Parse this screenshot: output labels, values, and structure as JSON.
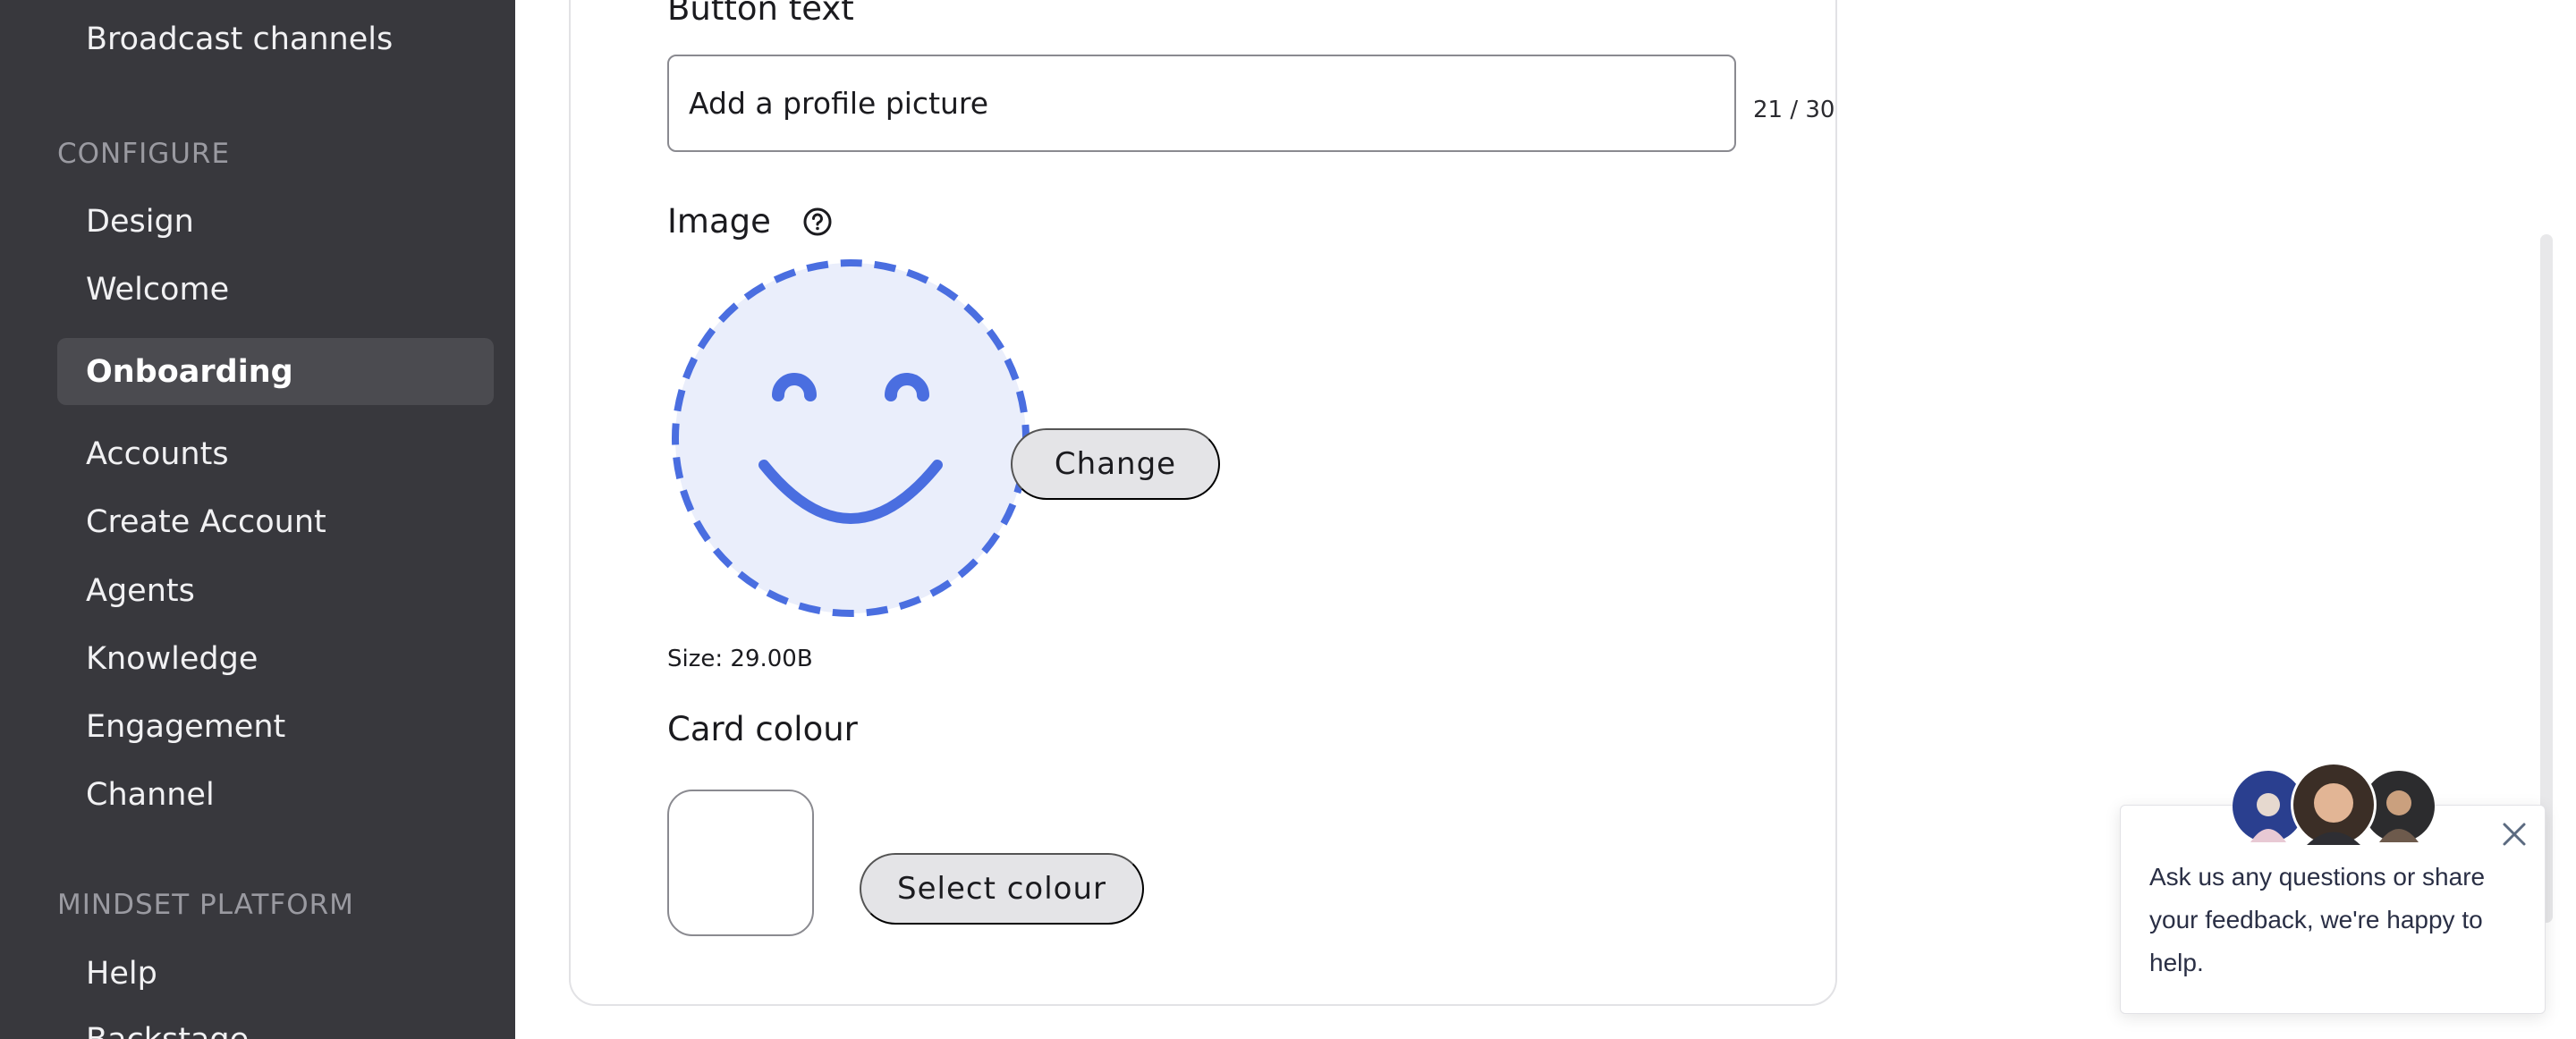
{
  "sidebar": {
    "items": [
      {
        "label": "Broadcast channels"
      },
      {
        "label": "Design"
      },
      {
        "label": "Welcome"
      },
      {
        "label": "Onboarding"
      },
      {
        "label": "Accounts"
      },
      {
        "label": "Create Account"
      },
      {
        "label": "Agents"
      },
      {
        "label": "Knowledge"
      },
      {
        "label": "Engagement"
      },
      {
        "label": "Channel"
      },
      {
        "label": "Help"
      },
      {
        "label": "Backstage"
      }
    ],
    "sections": [
      {
        "label": "CONFIGURE"
      },
      {
        "label": "MINDSET PLATFORM"
      }
    ],
    "active_item": "Onboarding"
  },
  "form": {
    "button_text_label": "Button text",
    "button_text_value": "Add a profile picture",
    "button_text_counter": "21 / 30",
    "image_label": "Image",
    "image_help_icon": "question-circle-icon",
    "image_preview_icon": "smiley-face-icon",
    "change_button": "Change",
    "size_text": "Size: 29.00B",
    "card_colour_label": "Card colour",
    "card_colour_value": "#ffffff",
    "select_colour_button": "Select colour"
  },
  "chat_widget": {
    "message": "Ask us any questions or share your feedback, we're happy to help.",
    "close_icon": "close-icon"
  },
  "colors": {
    "sidebar_bg": "#38383d",
    "sidebar_active_bg": "#4b4b50",
    "accent_blue": "#4a6ee0",
    "smiley_fill": "#eaeefb"
  }
}
